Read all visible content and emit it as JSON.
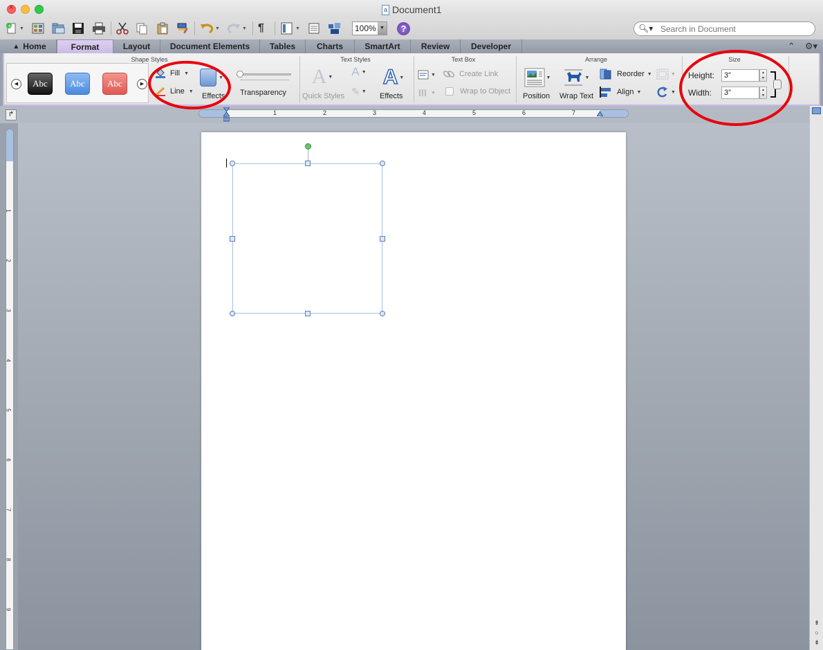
{
  "window": {
    "title": "Document1"
  },
  "toolbar": {
    "zoom": "100%",
    "search_placeholder": "Search in Document"
  },
  "tabs": [
    {
      "label": "Home"
    },
    {
      "label": "Format"
    },
    {
      "label": "Layout"
    },
    {
      "label": "Document Elements"
    },
    {
      "label": "Tables"
    },
    {
      "label": "Charts"
    },
    {
      "label": "SmartArt"
    },
    {
      "label": "Review"
    },
    {
      "label": "Developer"
    }
  ],
  "ribbon": {
    "shape_styles": {
      "title": "Shape Styles",
      "swatches": [
        "Abc",
        "Abc",
        "Abc"
      ],
      "fill": "Fill",
      "line": "Line",
      "effects": "Effects",
      "transparency": "Transparency"
    },
    "text_styles": {
      "title": "Text Styles",
      "quick_styles": "Quick Styles",
      "effects": "Effects"
    },
    "text_box": {
      "title": "Text Box",
      "create_link": "Create Link",
      "wrap_to_object": "Wrap to Object"
    },
    "arrange": {
      "title": "Arrange",
      "position": "Position",
      "wrap_text": "Wrap Text",
      "reorder": "Reorder",
      "align": "Align"
    },
    "size": {
      "title": "Size",
      "height_label": "Height:",
      "height_value": "3\"",
      "width_label": "Width:",
      "width_value": "3\""
    }
  },
  "ruler": {
    "h_numbers": [
      "1",
      "2",
      "3",
      "4",
      "5",
      "6",
      "7"
    ],
    "v_numbers": [
      "1",
      "2",
      "3",
      "4",
      "5",
      "6",
      "7",
      "8",
      "9"
    ]
  },
  "colors": {
    "format_tab": "#cbbbe6",
    "annotation": "#e8000b",
    "selection_handle": "#5d7fb4",
    "rotation_handle": "#6ac36f"
  }
}
